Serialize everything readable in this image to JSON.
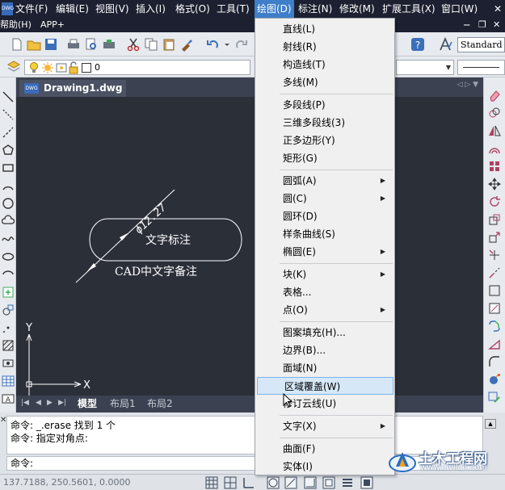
{
  "menubar": {
    "items": [
      "文件(F)",
      "编辑(E)",
      "视图(V)",
      "插入(I)",
      "格式(O)",
      "工具(T)",
      "绘图(D)",
      "标注(N)",
      "修改(M)",
      "扩展工具(X)",
      "窗口(W)"
    ],
    "active": "绘图(D)"
  },
  "helpbar": {
    "items": [
      "帮助(H)",
      "APP+"
    ]
  },
  "toolbar": {
    "text_style": "Standard",
    "layer_value": "0"
  },
  "document": {
    "tab_title": "Drawing1.dwg"
  },
  "canvas": {
    "dimension_text": "ϕ12.27",
    "shape_label": "文字标注",
    "note_text": "CAD中文字备注",
    "axis_x": "X",
    "axis_y": "Y"
  },
  "layout_tabs": [
    "模型",
    "布局1",
    "布局2"
  ],
  "command": {
    "history": [
      "命令:  _.erase 找到 1 个",
      "命令:  指定对角点:"
    ],
    "prompt": "命令:"
  },
  "status": {
    "coordinates": "137.7188, 250.5601, 0.0000"
  },
  "draw_menu": {
    "groups": [
      [
        "直线(L)",
        "射线(R)",
        "构造线(T)",
        "多线(M)"
      ],
      [
        "多段线(P)",
        "三维多段线(3)",
        "正多边形(Y)",
        "矩形(G)"
      ],
      [
        "圆弧(A)",
        "圆(C)",
        "圆环(D)",
        "样条曲线(S)",
        "椭圆(E)"
      ],
      [
        "块(K)",
        "表格...",
        "点(O)"
      ],
      [
        "图案填充(H)...",
        "边界(B)...",
        "面域(N)",
        "区域覆盖(W)",
        "修订云线(U)"
      ],
      [
        "文字(X)"
      ],
      [
        "曲面(F)",
        "实体(I)"
      ]
    ],
    "submenu_items": [
      "圆弧(A)",
      "圆(C)",
      "椭圆(E)",
      "块(K)",
      "点(O)",
      "文字(X)"
    ],
    "hovered": "区域覆盖(W)"
  },
  "watermark": {
    "title": "土木工程网",
    "url": "www.civilcn.com"
  },
  "colors": {
    "menubar_bg": "#1c2030",
    "canvas_bg": "#2b2f38",
    "menu_highlight": "#d6e8f8",
    "drawing_line": "#ffffff"
  }
}
